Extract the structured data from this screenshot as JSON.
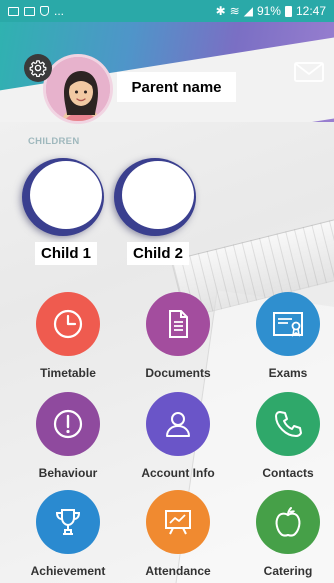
{
  "status_bar": {
    "left_text": "...",
    "battery": "91%",
    "time": "12:47"
  },
  "header": {
    "parent_name": "Parent name",
    "icons": {
      "settings": "gear-icon",
      "mail": "mail-icon"
    }
  },
  "children": {
    "label": "CHILDREN",
    "items": [
      {
        "name": "Child 1"
      },
      {
        "name": "Child 2"
      }
    ]
  },
  "menu": {
    "items": [
      {
        "label": "Timetable",
        "icon": "clock-icon",
        "color": "#ef5b4f"
      },
      {
        "label": "Documents",
        "icon": "document-icon",
        "color": "#a34d9e"
      },
      {
        "label": "Exams",
        "icon": "certificate-icon",
        "color": "#2f8fcf"
      },
      {
        "label": "Behaviour",
        "icon": "alert-icon",
        "color": "#8f4a9e"
      },
      {
        "label": "Account Info",
        "icon": "user-icon",
        "color": "#6a55c8"
      },
      {
        "label": "Contacts",
        "icon": "phone-icon",
        "color": "#2fa86a"
      },
      {
        "label": "Achievement",
        "icon": "trophy-icon",
        "color": "#2a8ad0"
      },
      {
        "label": "Attendance",
        "icon": "chart-board-icon",
        "color": "#f08a30"
      },
      {
        "label": "Catering",
        "icon": "apple-icon",
        "color": "#46a048"
      }
    ]
  }
}
